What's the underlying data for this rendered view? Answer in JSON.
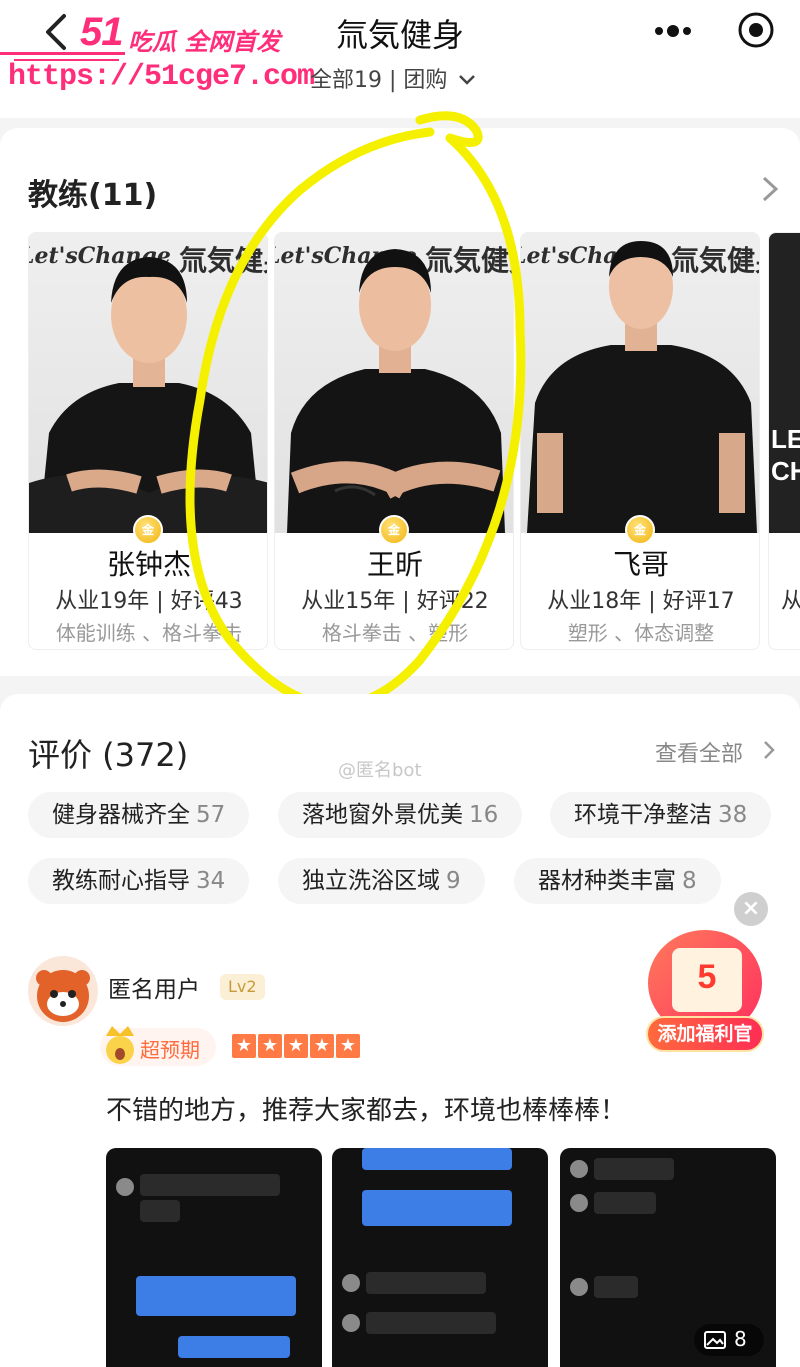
{
  "watermark": {
    "brand_number": "51",
    "brand_text": "吃瓜 全网首发",
    "url": "https://51cge7.com"
  },
  "header": {
    "title": "氚気健身",
    "subtitle": "全部19 | 团购"
  },
  "coaches": {
    "title": "教练(11)",
    "items": [
      {
        "name": "张钟杰",
        "stats": "从业19年 | 好评43",
        "tags": "体能训练 、格斗拳击",
        "wall_en": "Let'sChange",
        "wall_cn": "氚気健身"
      },
      {
        "name": "王昕",
        "stats": "从业15年 | 好评22",
        "tags": "格斗拳击 、塑形",
        "wall_en": "Let'sChange",
        "wall_cn": "氚気健身"
      },
      {
        "name": "飞哥",
        "stats": "从业18年 | 好评17",
        "tags": "塑形 、体态调整",
        "wall_en": "Let'sChange",
        "wall_cn": "氚気健身"
      }
    ],
    "partial": {
      "text": "LE CH",
      "stats": "从"
    },
    "medal_label": "金"
  },
  "reviews": {
    "title": "评价 (372)",
    "view_all": "查看全部",
    "source_watermark": "@匿名bot",
    "tags": [
      {
        "label": "健身器械齐全",
        "count": "57"
      },
      {
        "label": "落地窗外景优美",
        "count": "16"
      },
      {
        "label": "环境干净整洁",
        "count": "38"
      },
      {
        "label": "教练耐心指导",
        "count": "34"
      },
      {
        "label": "独立洗浴区域",
        "count": "9"
      },
      {
        "label": "器材种类丰富",
        "count": "8"
      }
    ],
    "first": {
      "user": "匿名用户",
      "level": "Lv2",
      "expectation": "超预期",
      "rating": 5,
      "text": "不错的地方，推荐大家都去，环境也棒棒棒！",
      "photo_count": "8"
    }
  },
  "floating": {
    "welfare_amount": "5",
    "welfare_label": "添加福利官",
    "close": "×"
  },
  "colors": {
    "accent": "#ff7a45",
    "watermark": "#ff2e7a",
    "highlight": "#f5f000"
  }
}
